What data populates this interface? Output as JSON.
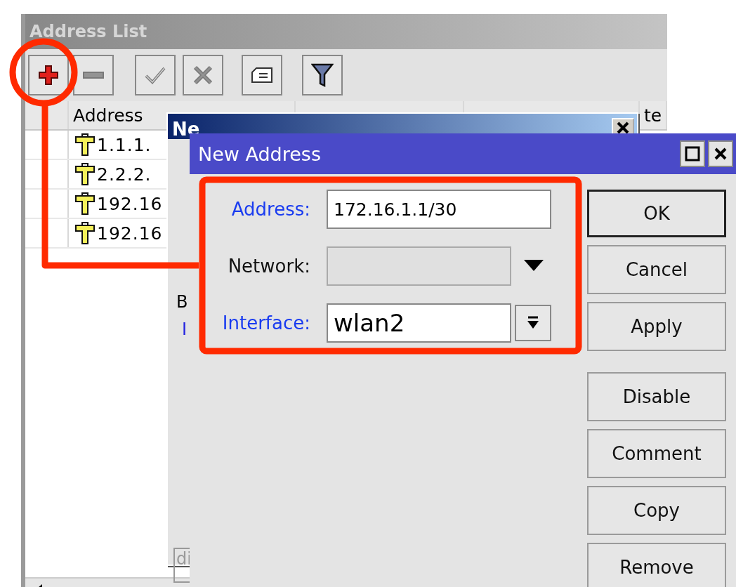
{
  "address_list_window": {
    "title": "Address List",
    "toolbar": [
      {
        "kind": "add",
        "disabled": false
      },
      {
        "kind": "remove",
        "disabled": true
      },
      {
        "kind": "enable",
        "disabled": true
      },
      {
        "kind": "disable",
        "disabled": true
      },
      {
        "kind": "comment",
        "disabled": false
      },
      {
        "kind": "filter",
        "disabled": false
      }
    ],
    "columns": [
      {
        "label": "Address"
      },
      {
        "blank": true
      },
      {
        "blank": true
      },
      {
        "label": "te"
      }
    ],
    "rows": [
      {
        "address": "1.1.1."
      },
      {
        "address": "2.2.2."
      },
      {
        "address": "192.16"
      },
      {
        "address": "192.16"
      }
    ]
  },
  "back_dialog": {
    "title": "Ne",
    "label_1": "B",
    "label_2": "I",
    "field_1": "di"
  },
  "new_address_dialog": {
    "title": "New Address",
    "fields": [
      {
        "label": "Address:",
        "kind": "text",
        "value": "172.16.1.1/30",
        "highlighted": true
      },
      {
        "label": "Network:",
        "kind": "dropdown_disabled",
        "highlighted": false
      },
      {
        "label": "Interface:",
        "kind": "select",
        "value": "wlan2",
        "highlighted": true
      }
    ],
    "button_groups": [
      {
        "buttons": [
          {
            "label": "OK",
            "default": true
          },
          {
            "label": "Cancel",
            "default": false
          },
          {
            "label": "Apply",
            "default": false
          }
        ]
      },
      {
        "buttons": [
          {
            "label": "Disable",
            "default": false
          },
          {
            "label": "Comment",
            "default": false
          },
          {
            "label": "Copy",
            "default": false
          },
          {
            "label": "Remove",
            "default": false
          }
        ]
      }
    ]
  }
}
